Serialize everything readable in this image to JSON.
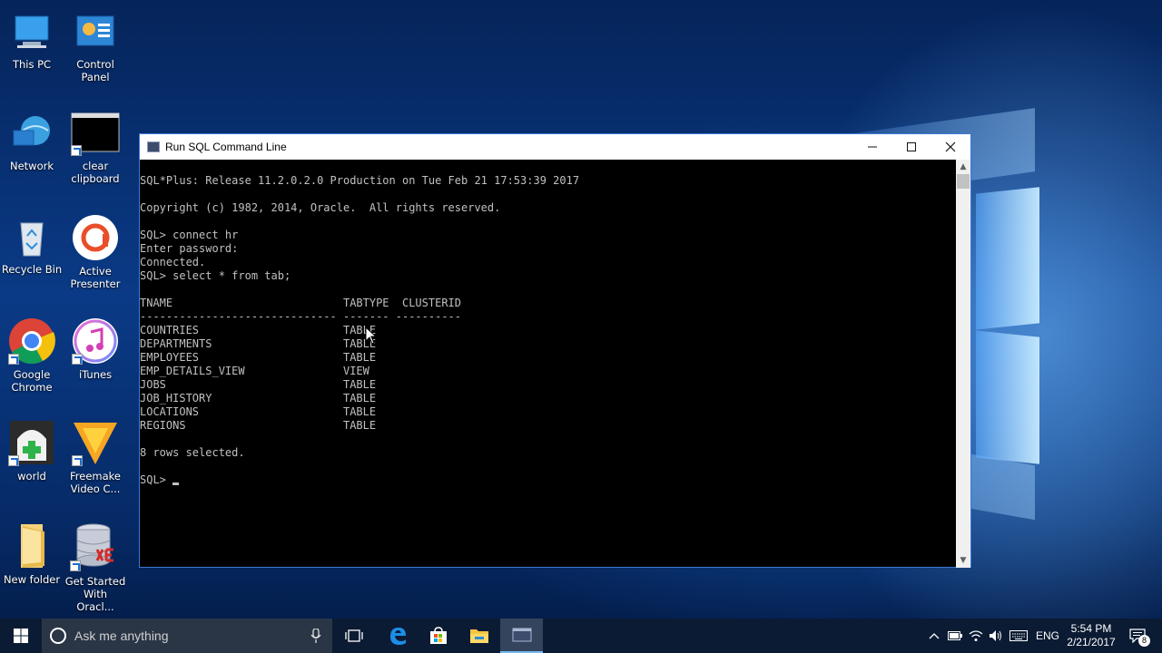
{
  "desktop": {
    "icons": [
      {
        "label": "This PC"
      },
      {
        "label": "Control\nPanel"
      },
      {
        "label": "Network"
      },
      {
        "label": "clear\nclipboard"
      },
      {
        "label": "Recycle Bin"
      },
      {
        "label": "Active\nPresenter"
      },
      {
        "label": "Google\nChrome"
      },
      {
        "label": "iTunes"
      },
      {
        "label": "world"
      },
      {
        "label": "Freemake\nVideo C..."
      },
      {
        "label": "New folder"
      },
      {
        "label": "Get Started\nWith Oracl..."
      }
    ]
  },
  "window": {
    "title": "Run SQL Command Line",
    "lines": [
      "SQL*Plus: Release 11.2.0.2.0 Production on Tue Feb 21 17:53:39 2017",
      "Copyright (c) 1982, 2014, Oracle.  All rights reserved.",
      "SQL> connect hr",
      "Enter password:",
      "Connected.",
      "SQL> select * from tab;",
      "TNAME                          TABTYPE  CLUSTERID",
      "------------------------------ ------- ----------",
      "COUNTRIES                      TABLE",
      "DEPARTMENTS                    TABLE",
      "EMPLOYEES                      TABLE",
      "EMP_DETAILS_VIEW               VIEW",
      "JOBS                           TABLE",
      "JOB_HISTORY                    TABLE",
      "LOCATIONS                      TABLE",
      "REGIONS                        TABLE",
      "8 rows selected.",
      "SQL> "
    ]
  },
  "taskbar": {
    "search_placeholder": "Ask me anything",
    "language": "ENG",
    "time": "5:54 PM",
    "date": "2/21/2017",
    "notification_count": "8"
  }
}
